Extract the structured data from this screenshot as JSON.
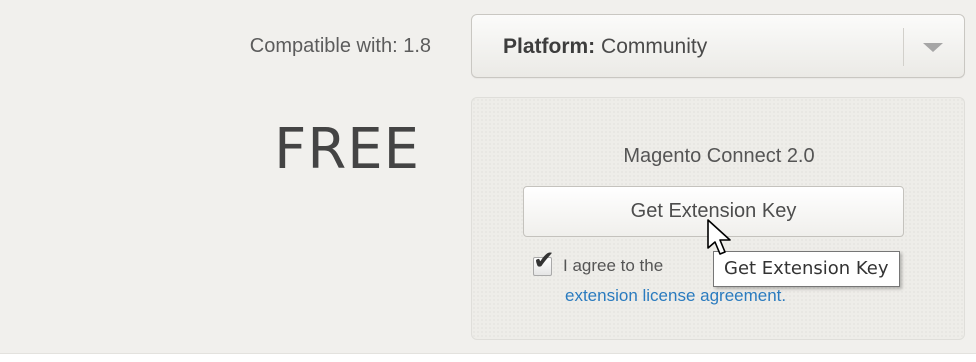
{
  "product": {
    "compatible_label": "Compatible with: 1.8",
    "price": "FREE"
  },
  "platform_select": {
    "label": "Platform:",
    "value": "Community",
    "icon": "chevron-down-icon"
  },
  "connect": {
    "title": "Magento Connect 2.0",
    "button_label": "Get Extension Key",
    "agree_checked": true,
    "agree_text": "I agree to the",
    "license_link": "extension license agreement."
  },
  "tooltip": {
    "text": "Get Extension Key"
  },
  "colors": {
    "panel_background": "#f1f0ed",
    "link": "#2a7bbf",
    "price_text": "#444444"
  }
}
